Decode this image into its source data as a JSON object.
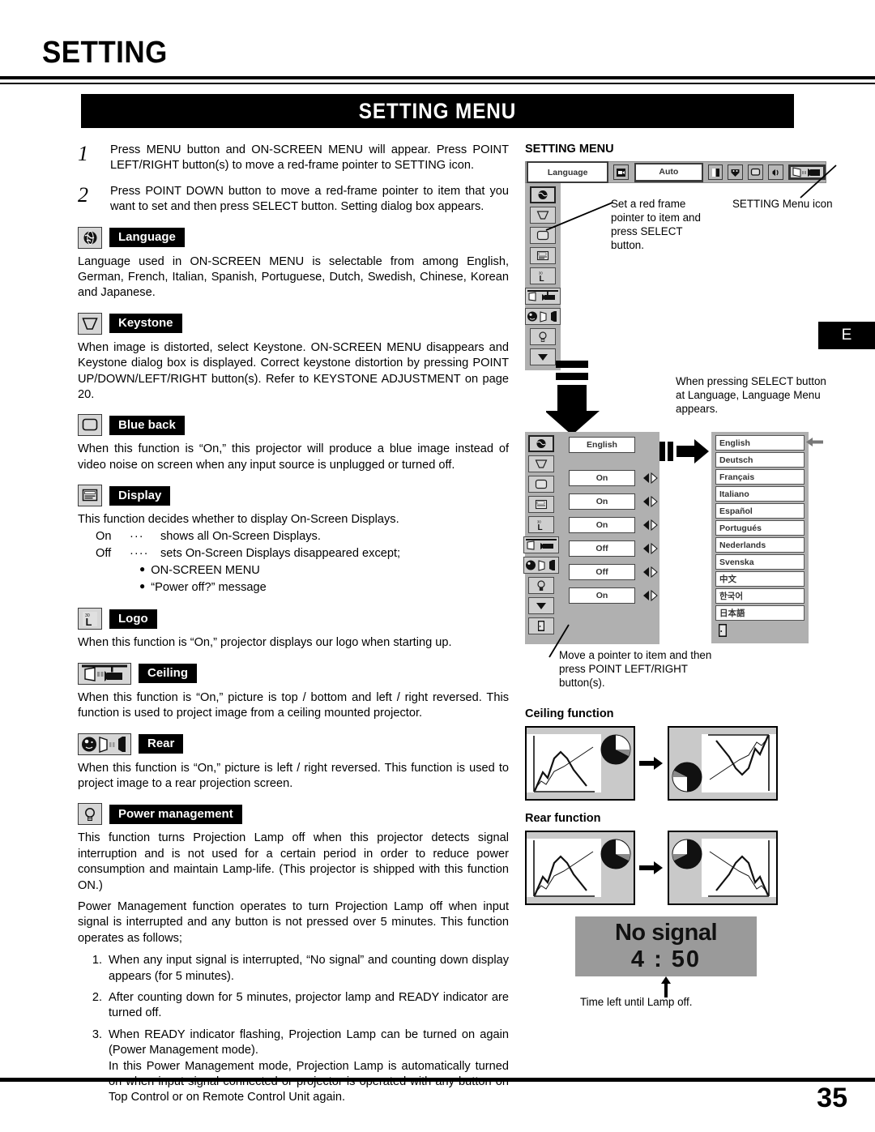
{
  "page": {
    "title": "SETTING",
    "banner": "SETTING MENU",
    "edition_tab": "E",
    "page_number": "35"
  },
  "steps": [
    {
      "num": "1",
      "text": "Press MENU button and ON-SCREEN MENU will appear.  Press POINT LEFT/RIGHT button(s) to move a red-frame pointer to SETTING icon."
    },
    {
      "num": "2",
      "text": "Press POINT DOWN button to move a red-frame pointer to item that you want to set and then press SELECT button.  Setting dialog box appears."
    }
  ],
  "sections": [
    {
      "key": "language",
      "icon": "globe-icon",
      "label": "Language",
      "body": "Language used in ON-SCREEN MENU is selectable from among English, German, French, Italian, Spanish, Portuguese, Dutch, Swedish, Chinese, Korean and Japanese."
    },
    {
      "key": "keystone",
      "icon": "keystone-trapezoid-icon",
      "label": "Keystone",
      "body": "When image is distorted, select Keystone.  ON-SCREEN MENU disappears and Keystone dialog box is displayed.  Correct keystone distortion by pressing POINT UP/DOWN/LEFT/RIGHT button(s). Refer to KEYSTONE ADJUSTMENT on page 20."
    },
    {
      "key": "blue-back",
      "icon": "blue-back-screen-icon",
      "label": "Blue back",
      "body": "When this function is “On,” this projector will produce a blue image instead of video noise on screen when any input source is unplugged or turned off."
    },
    {
      "key": "display",
      "icon": "display-screen-icon",
      "label": "Display",
      "body": "This function decides whether to display On-Screen Displays.",
      "options": [
        {
          "key": "On",
          "dots": "···",
          "text": "shows all On-Screen Displays."
        },
        {
          "key": "Off",
          "dots": "····",
          "text": "sets On-Screen Displays disappeared except;"
        }
      ],
      "bullets": [
        "ON-SCREEN MENU",
        "“Power off?” message"
      ]
    },
    {
      "key": "logo",
      "icon": "logo-L-icon",
      "label": "Logo",
      "body": "When this function is “On,” projector displays our logo when starting up."
    },
    {
      "key": "ceiling",
      "icon": "ceiling-mount-icon",
      "label": "Ceiling",
      "body": "When this function is “On,” picture is top / bottom and left / right reversed.  This function is used to project image from a ceiling mounted projector."
    },
    {
      "key": "rear",
      "icon": "rear-projection-icon",
      "label": "Rear",
      "body": "When this function is “On,” picture is left / right reversed.  This function is used to project image to a rear projection screen."
    },
    {
      "key": "power-management",
      "icon": "lamp-bulb-icon",
      "label": "Power management",
      "body": "This function turns Projection Lamp off when this projector detects signal interruption and is not used for a certain period in order to reduce power consumption and maintain Lamp-life.  (This projector is shipped with this function ON.)",
      "body2": "Power Management function operates to turn Projection Lamp off when input signal is interrupted and any button is not pressed over 5 minutes. This function operates as follows;",
      "numbered": [
        {
          "n": "1.",
          "text": "When any input signal is interrupted, “No signal” and counting down display appears (for 5 minutes)."
        },
        {
          "n": "2.",
          "text": "After counting down for 5 minutes, projector lamp and READY indicator are turned off."
        },
        {
          "n": "3.",
          "text": "When READY indicator flashing, Projection Lamp can be turned on again (Power Management mode)."
        }
      ],
      "numbered_cont": "In this Power Management mode, Projection Lamp is automatically turned on when input signal connected or projector is operated with any button on Top Control or on Remote Control Unit again."
    }
  ],
  "right": {
    "menu_heading": "SETTING MENU",
    "menubar": {
      "selected_label": "Language",
      "auto_label": "Auto",
      "icons": [
        "input-source-icon",
        "image-adjust-icon",
        "image-select-icon",
        "screen-icon",
        "sound-icon",
        "setting-icon"
      ]
    },
    "callout_left": "Set a red frame pointer to item and press SELECT button.",
    "callout_right": "SETTING Menu icon",
    "callout_select": "When pressing SELECT button at Language, Language Menu appears.",
    "callout_move": "Move a pointer to item and then press POINT LEFT/RIGHT button(s).",
    "dialog": {
      "language_value": "English",
      "values": [
        "On",
        "On",
        "On",
        "Off",
        "Off",
        "On"
      ]
    },
    "languages": [
      "English",
      "Deutsch",
      "Français",
      "Italiano",
      "Español",
      "Portugués",
      "Nederlands",
      "Svenska",
      "中文",
      "한국어",
      "日本語"
    ],
    "ceiling_heading": "Ceiling function",
    "rear_heading": "Rear function",
    "no_signal": {
      "line1": "No signal",
      "time": "4 : 50",
      "caption": "Time left until Lamp off."
    }
  },
  "colors": {
    "ink": "#000000",
    "menu_gray": "#b0b0b0",
    "icon_gray": "#cfcfcf",
    "screen_gray": "#9a9a9a"
  }
}
